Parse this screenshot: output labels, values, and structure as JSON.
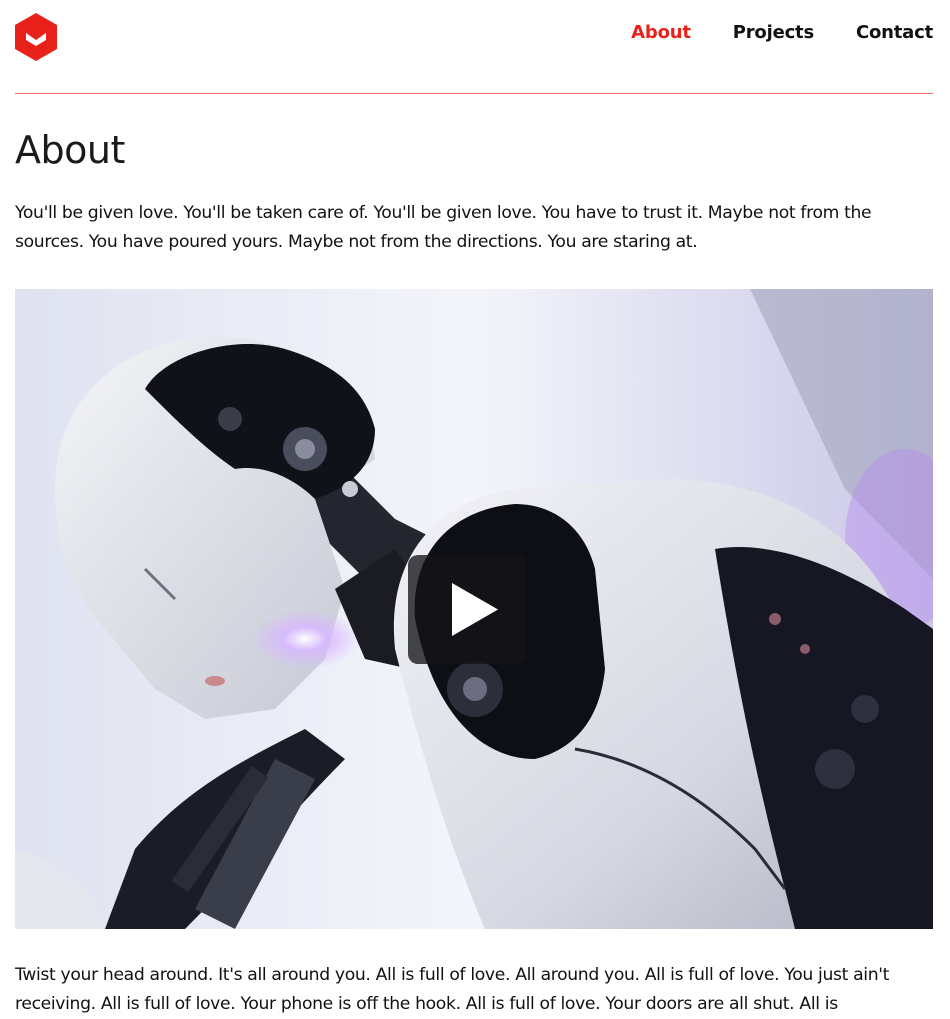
{
  "header": {
    "logo_icon": "hexagon-chevron-logo",
    "brand_color": "#e8221b",
    "nav": [
      {
        "label": "About",
        "active": true
      },
      {
        "label": "Projects",
        "active": false
      },
      {
        "label": "Contact",
        "active": false
      }
    ]
  },
  "main": {
    "title": "About",
    "intro": "You'll be given love. You'll be taken care of. You'll be given love. You have to trust it. Maybe not from the sources. You have poured yours. Maybe not from the directions. You are staring at.",
    "video": {
      "play_icon": "play-icon"
    },
    "body": "Twist your head around. It's all around you. All is full of love. All around you. All is full of love. You just ain't receiving. All is full of love. Your phone is off the hook. All is full of love. Your doors are all shut. All is"
  }
}
